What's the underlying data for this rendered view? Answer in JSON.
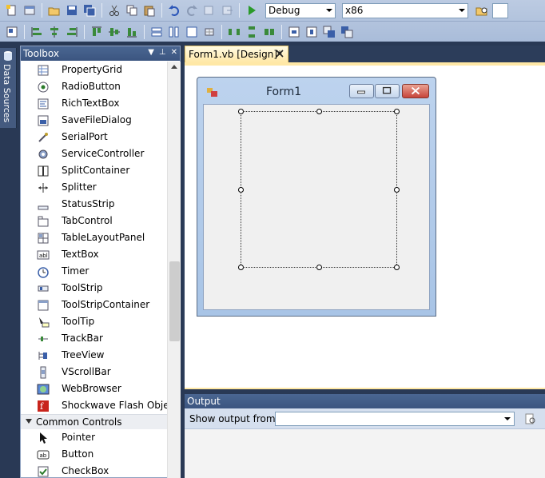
{
  "toolbar": {
    "config_value": "Debug",
    "platform_value": "x86"
  },
  "side_tab": {
    "label": "Data Sources"
  },
  "toolbox": {
    "title": "Toolbox",
    "items": [
      {
        "label": "PropertyGrid",
        "icon": "property-grid-icon"
      },
      {
        "label": "RadioButton",
        "icon": "radio-button-icon"
      },
      {
        "label": "RichTextBox",
        "icon": "rich-text-box-icon"
      },
      {
        "label": "SaveFileDialog",
        "icon": "save-file-dialog-icon"
      },
      {
        "label": "SerialPort",
        "icon": "serial-port-icon"
      },
      {
        "label": "ServiceController",
        "icon": "service-controller-icon"
      },
      {
        "label": "SplitContainer",
        "icon": "split-container-icon"
      },
      {
        "label": "Splitter",
        "icon": "splitter-icon"
      },
      {
        "label": "StatusStrip",
        "icon": "status-strip-icon"
      },
      {
        "label": "TabControl",
        "icon": "tab-control-icon"
      },
      {
        "label": "TableLayoutPanel",
        "icon": "table-layout-panel-icon"
      },
      {
        "label": "TextBox",
        "icon": "text-box-icon"
      },
      {
        "label": "Timer",
        "icon": "timer-icon"
      },
      {
        "label": "ToolStrip",
        "icon": "tool-strip-icon"
      },
      {
        "label": "ToolStripContainer",
        "icon": "tool-strip-container-icon"
      },
      {
        "label": "ToolTip",
        "icon": "tool-tip-icon"
      },
      {
        "label": "TrackBar",
        "icon": "track-bar-icon"
      },
      {
        "label": "TreeView",
        "icon": "tree-view-icon"
      },
      {
        "label": "VScrollBar",
        "icon": "vscroll-bar-icon"
      },
      {
        "label": "WebBrowser",
        "icon": "web-browser-icon"
      },
      {
        "label": "Shockwave Flash Object",
        "icon": "flash-icon"
      }
    ],
    "category": "Common Controls",
    "common_items": [
      {
        "label": "Pointer",
        "icon": "pointer-icon"
      },
      {
        "label": "Button",
        "icon": "button-icon"
      },
      {
        "label": "CheckBox",
        "icon": "checkbox-icon"
      }
    ]
  },
  "document": {
    "tab_label": "Form1.vb [Design]*",
    "form_title": "Form1"
  },
  "output": {
    "title": "Output",
    "show_label": "Show output from:",
    "show_value": ""
  }
}
